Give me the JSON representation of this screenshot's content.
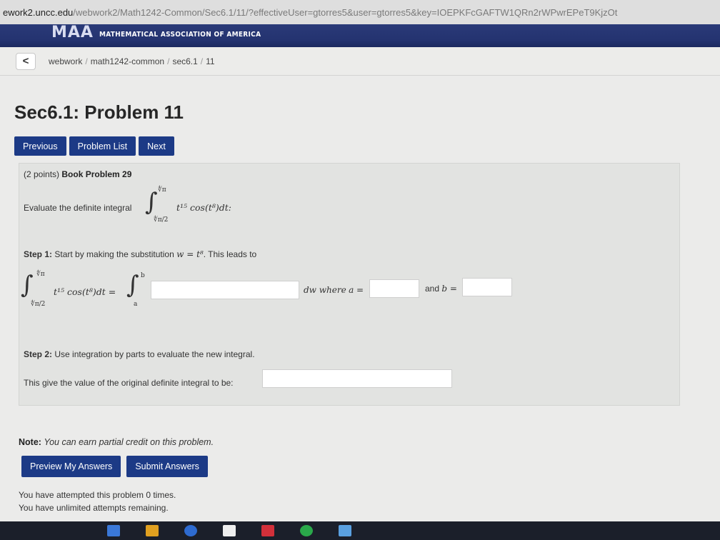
{
  "browser": {
    "url_prefix": "ework2.uncc.edu",
    "url_rest": "/webwork2/Math1242-Common/Sec6.1/11/?effectiveUser=gtorres5&user=gtorres5&key=IOEPKFcGAFTW1QRn2rWPwrEPeT9KjzOt"
  },
  "banner": {
    "logo": "MAA",
    "name": "MATHEMATICAL ASSOCIATION OF AMERICA"
  },
  "breadcrumb": {
    "back": "<",
    "items": [
      "webwork",
      "math1242-common",
      "sec6.1",
      "11"
    ]
  },
  "page": {
    "title": "Sec6.1: Problem 11"
  },
  "nav": {
    "previous": "Previous",
    "problem_list": "Problem List",
    "next": "Next"
  },
  "problem": {
    "points": "(2 points)",
    "source": "Book Problem 29",
    "prompt": "Evaluate the definite integral",
    "upper_limit": "∜π",
    "lower_limit": "∜π/2",
    "integrand": "t¹⁵ cos(t⁸)dt:",
    "step1_label": "Step 1:",
    "step1_text": "Start by making the substitution",
    "step1_sub": "w = t⁸",
    "step1_after": ". This leads to",
    "eq_lhs": "t¹⁵ cos(t⁸)dt =",
    "eq_upper_b": "b",
    "eq_lower_a": "a",
    "dw_where": "dw where",
    "a_label": "a =",
    "and_b": "and",
    "b_label": "b =",
    "step2_label": "Step 2:",
    "step2_text": "Use integration by parts to evaluate the new integral.",
    "final_label": "This give the value of the original definite integral to be:",
    "answers": {
      "integrand": "",
      "a": "",
      "b": "",
      "final": ""
    }
  },
  "note": {
    "label": "Note:",
    "text": "You can earn partial credit on this problem."
  },
  "actions": {
    "preview": "Preview My Answers",
    "submit": "Submit Answers"
  },
  "status": {
    "attempts": "You have attempted this problem 0 times.",
    "remaining": "You have unlimited attempts remaining."
  }
}
